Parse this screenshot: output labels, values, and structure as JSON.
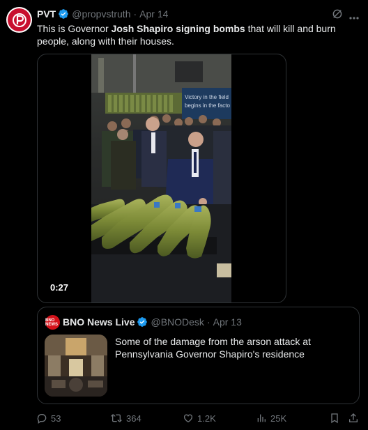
{
  "author": {
    "name": "PVT",
    "handle": "@propvstruth",
    "separator": "·",
    "date": "Apr 14"
  },
  "tweet": {
    "text_parts": [
      "This is Governor ",
      "Josh Shapiro signing bombs",
      " that will kill and burn people, along with their houses."
    ]
  },
  "media": {
    "duration": "0:27",
    "sign_text_line1": "Victory in the field",
    "sign_text_line2": "begins in the facto"
  },
  "quote": {
    "avatar_text": "BNO NEWS",
    "name": "BNO News Live",
    "handle": "@BNODesk",
    "separator": "·",
    "date": "Apr 13",
    "text": "Some of the damage from the arson attack at Pennsylvania Governor Shapiro's residence"
  },
  "actions": {
    "replies": "53",
    "reposts": "364",
    "likes": "1.2K",
    "views": "25K"
  },
  "colors": {
    "verified": "#1d9bf0",
    "muted": "#71767b",
    "border": "#2f3336",
    "avatar_red": "#c8102e"
  },
  "icons": [
    "verified-badge-icon",
    "grok-icon",
    "more-icon",
    "reply-icon",
    "repost-icon",
    "like-icon",
    "views-icon",
    "bookmark-icon",
    "share-icon"
  ]
}
